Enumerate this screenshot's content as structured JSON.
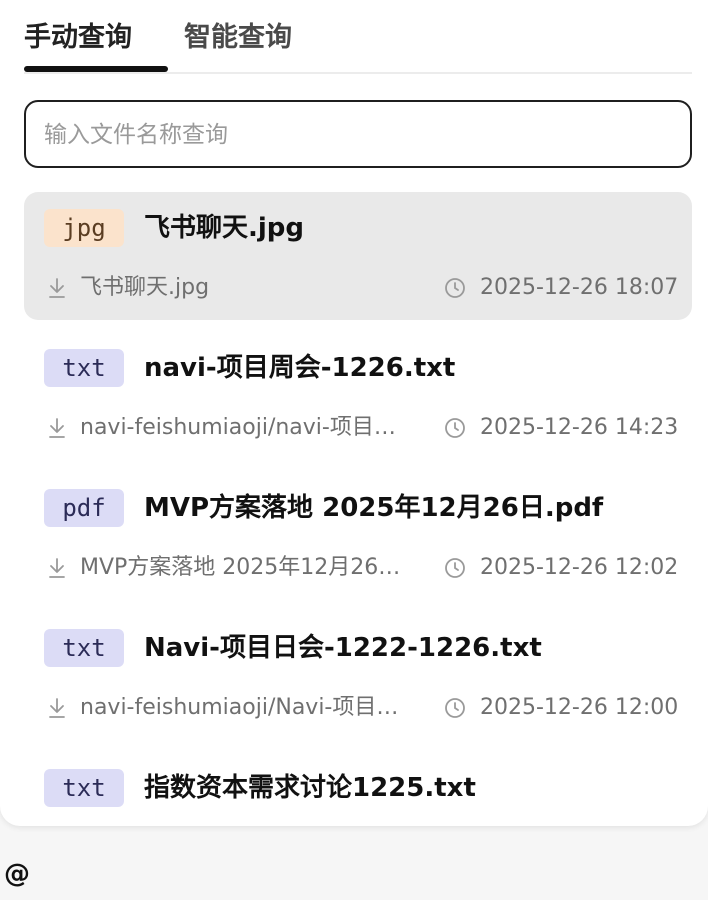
{
  "tabs": {
    "manual_label": "手动查询",
    "smart_label": "智能查询"
  },
  "search": {
    "placeholder": "输入文件名称查询",
    "value": ""
  },
  "files": [
    {
      "type": "jpg",
      "name": "飞书聊天.jpg",
      "path": "飞书聊天.jpg",
      "time": "2025-12-26 18:07",
      "selected": true
    },
    {
      "type": "txt",
      "name": "navi-项目周会-1226.txt",
      "path": "navi-feishumiaoji/navi-项目…",
      "time": "2025-12-26 14:23"
    },
    {
      "type": "pdf",
      "name": "MVP方案落地 2025年12月26日.pdf",
      "path": "MVP方案落地 2025年12月26…",
      "time": "2025-12-26 12:02"
    },
    {
      "type": "txt",
      "name": "Navi-项目日会-1222-1226.txt",
      "path": "navi-feishumiaoji/Navi-项目…",
      "time": "2025-12-26 12:00"
    },
    {
      "type": "txt",
      "name": "指数资本需求讨论1225.txt"
    }
  ],
  "badge_colors": {
    "jpg": {
      "bg": "#fbe3cc",
      "fg": "#5a3d22"
    },
    "txt": {
      "bg": "#dcdcf6",
      "fg": "#2b2b57"
    },
    "pdf": {
      "bg": "#dcdcf6",
      "fg": "#2b2b57"
    }
  },
  "icons": {
    "download": "download-icon",
    "clock": "clock-icon"
  },
  "footer": {
    "mention_symbol": "@"
  }
}
